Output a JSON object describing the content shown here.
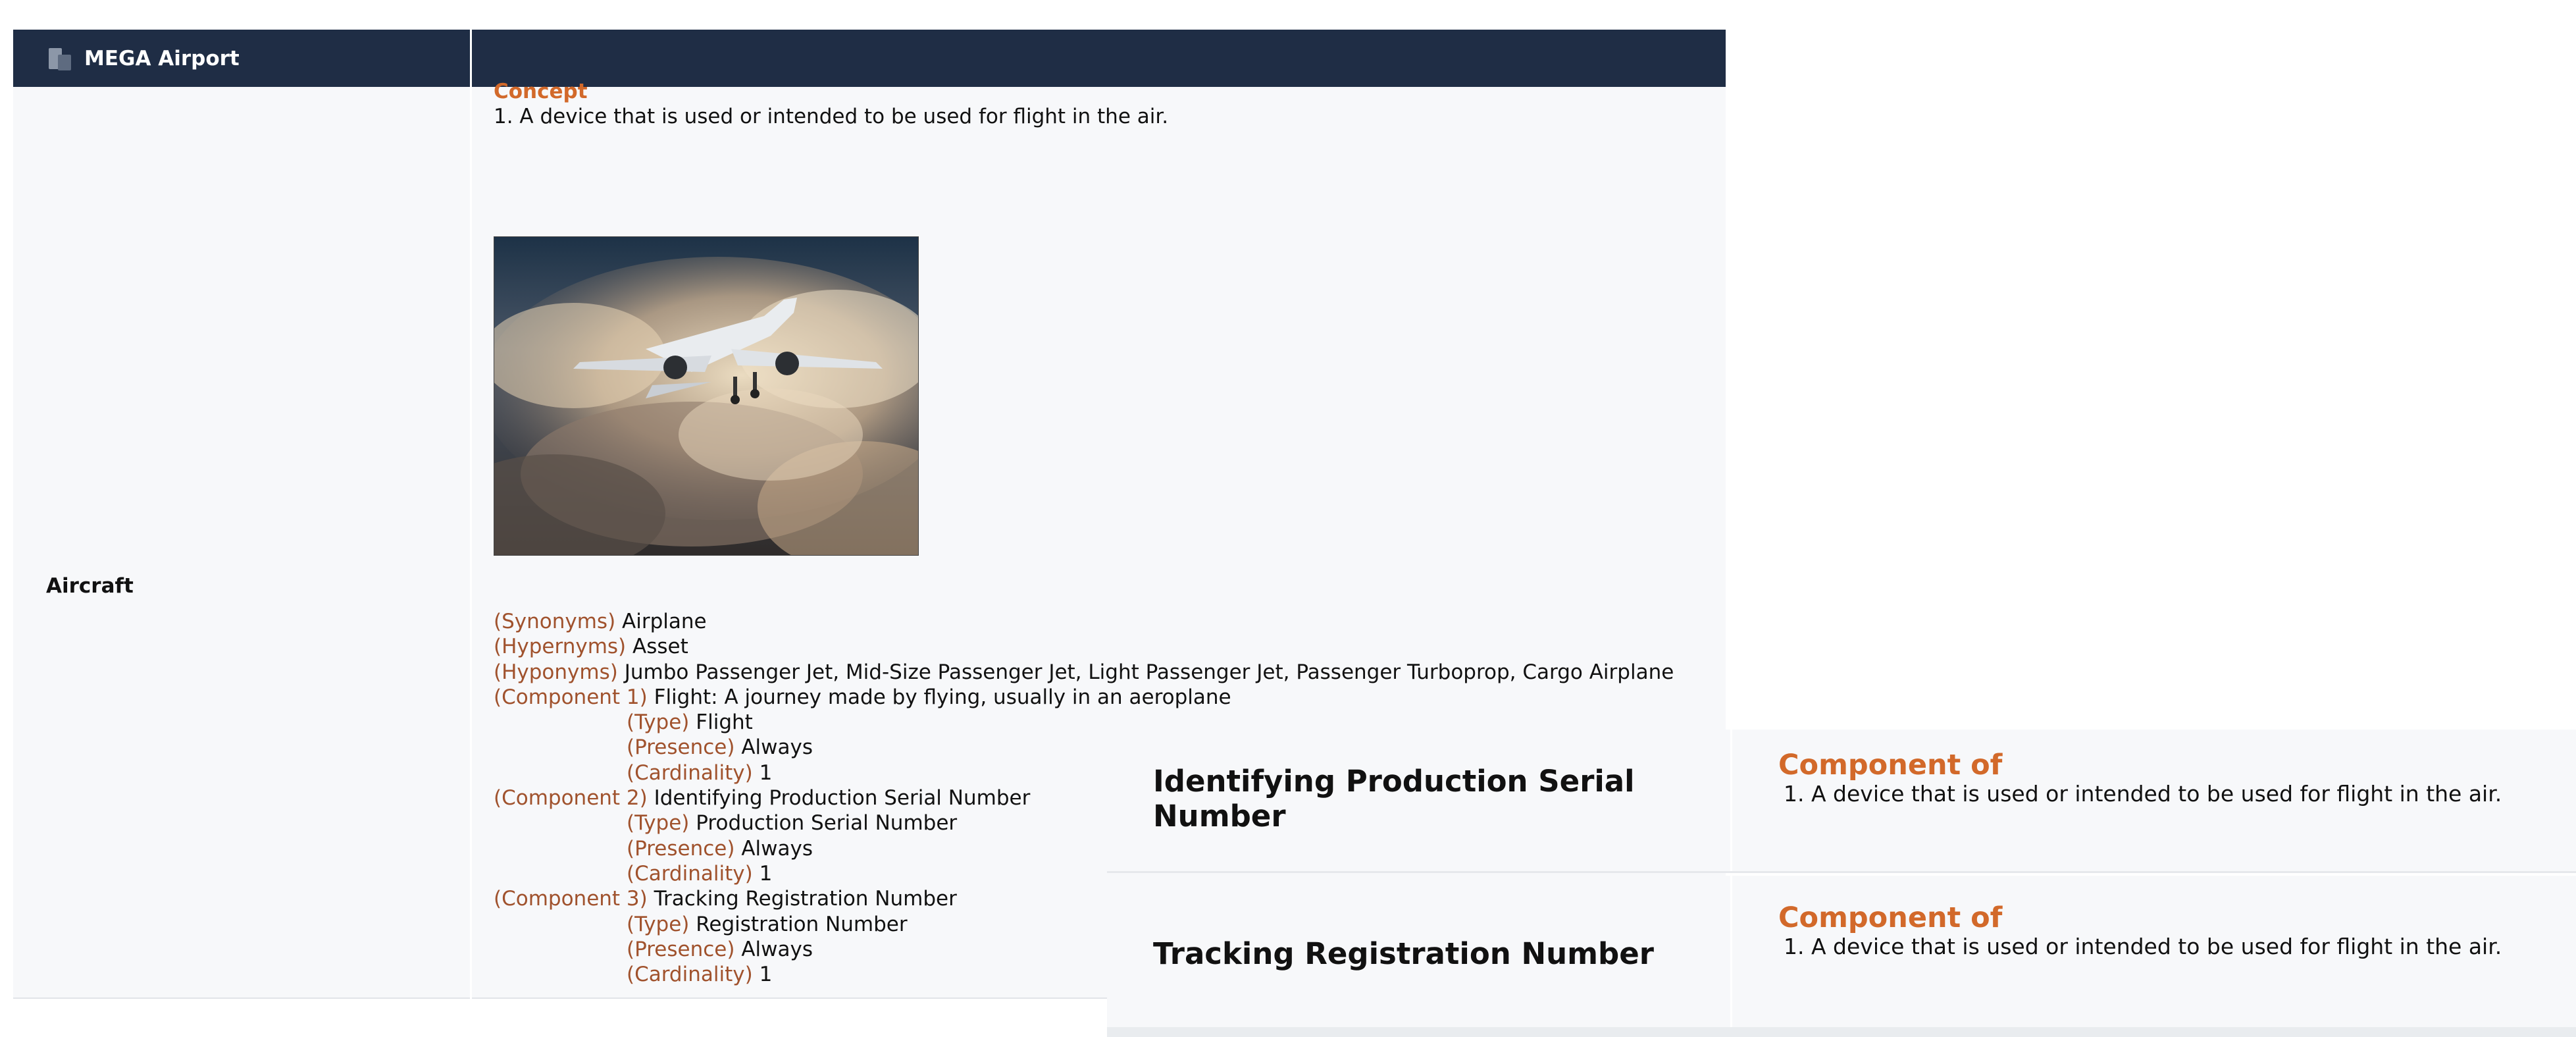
{
  "header": {
    "app_title": "MEGA Airport",
    "app_icon": "building-icon"
  },
  "term": "Aircraft",
  "concept": {
    "heading": "Concept",
    "definition": "1. A device that is used or intended to be used for flight in the air."
  },
  "image": {
    "description": "airplane-photo"
  },
  "relations": {
    "synonyms": {
      "label": "(Synonyms)",
      "value": "Airplane"
    },
    "hypernyms": {
      "label": "(Hypernyms)",
      "value": "Asset"
    },
    "hyponyms": {
      "label": "(Hyponyms)",
      "value": "Jumbo Passenger Jet, Mid-Size Passenger Jet, Light Passenger Jet, Passenger Turboprop, Cargo Airplane"
    },
    "components": [
      {
        "label": "(Component 1)",
        "value": "Flight: A journey made by flying, usually in an aeroplane",
        "type_label": "(Type)",
        "type_value": "Flight",
        "presence_label": "(Presence)",
        "presence_value": "Always",
        "cardinality_label": "(Cardinality)",
        "cardinality_value": "1"
      },
      {
        "label": "(Component 2)",
        "value": "Identifying Production Serial Number",
        "type_label": "(Type)",
        "type_value": "Production Serial Number",
        "presence_label": "(Presence)",
        "presence_value": "Always",
        "cardinality_label": "(Cardinality)",
        "cardinality_value": "1"
      },
      {
        "label": "(Component 3)",
        "value": "Tracking Registration Number",
        "type_label": "(Type)",
        "type_value": "Registration Number",
        "presence_label": "(Presence)",
        "presence_value": "Always",
        "cardinality_label": "(Cardinality)",
        "cardinality_value": "1"
      }
    ]
  },
  "cards": [
    {
      "term": "Identifying Production Serial Number",
      "heading": "Component of",
      "definition": "1. A device that is used or intended to be used for flight in the air."
    },
    {
      "term": "Tracking Registration Number",
      "heading": "Component of",
      "definition": "1. A device that is used or intended to be used for flight in the air."
    }
  ],
  "colors": {
    "header_bg": "#1f2d45",
    "accent_orange": "#d2692a",
    "relation_label": "#a0522d",
    "row_bg": "#f7f8fa"
  }
}
